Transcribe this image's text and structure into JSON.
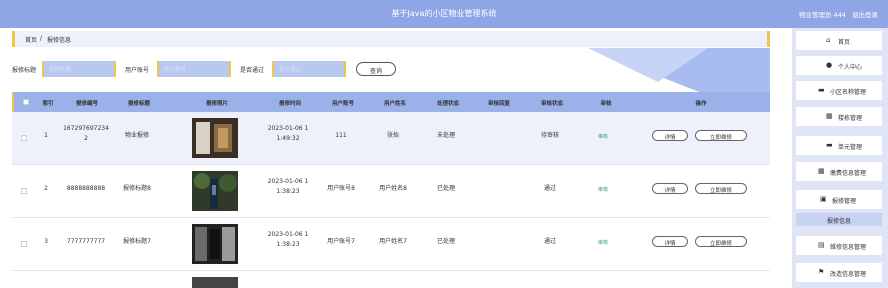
{
  "header": {
    "title": "基于Java的小区物业管理系统",
    "user": "物业管理员 444",
    "logout": "退出登录"
  },
  "breadcrumb": {
    "home": "首页",
    "sep": "/",
    "current": "报修信息"
  },
  "search": {
    "f1_label": "报修标题",
    "f1_placeholder": "报修标题",
    "f2_label": "用户账号",
    "f2_placeholder": "用户账号",
    "f3_label": "是否通过",
    "f3_placeholder": "是否通过",
    "button": "查询"
  },
  "table": {
    "headers": [
      "索引",
      "报修编号",
      "报修标题",
      "报修照片",
      "报修时间",
      "用户账号",
      "用户姓名",
      "处理状态",
      "审核回复",
      "审核状态",
      "审核",
      "操作"
    ],
    "rows": [
      {
        "index": "1",
        "no_a": "167297697234",
        "no_b": "2",
        "title": "物业报修",
        "time_a": "2023-01-06 1",
        "time_b": "1:49:32",
        "account": "111",
        "name": "张怡",
        "proc": "未处理",
        "reply": "",
        "status": "待审核",
        "audit": "审核",
        "detail": "详情",
        "repair": "立即维修"
      },
      {
        "index": "2",
        "no_a": "8888888888",
        "no_b": "",
        "title": "报修标题8",
        "time_a": "2023-01-06 1",
        "time_b": "1:38:23",
        "account": "用户账号8",
        "name": "用户姓名8",
        "proc": "已处理",
        "reply": "",
        "status": "通过",
        "audit": "审核",
        "detail": "详情",
        "repair": "立即维修"
      },
      {
        "index": "3",
        "no_a": "7777777777",
        "no_b": "",
        "title": "报修标题7",
        "time_a": "2023-01-06 1",
        "time_b": "1:38:23",
        "account": "用户账号7",
        "name": "用户姓名7",
        "proc": "已处理",
        "reply": "",
        "status": "通过",
        "audit": "审核",
        "detail": "详情",
        "repair": "立即维修"
      }
    ]
  },
  "sidebar": {
    "items": [
      {
        "icon": "home-icon",
        "glyph": "⌂",
        "label": "首页"
      },
      {
        "icon": "person-icon",
        "glyph": "●",
        "label": "个人中心"
      },
      {
        "icon": "community-icon",
        "glyph": "▬",
        "label": "小区名称管理"
      },
      {
        "icon": "building-icon",
        "glyph": "▦",
        "label": "楼栋管理"
      },
      {
        "icon": "unit-icon",
        "glyph": "▬",
        "label": "单元管理"
      },
      {
        "icon": "fee-icon",
        "glyph": "▦",
        "label": "缴费信息管理"
      },
      {
        "icon": "repair-icon",
        "glyph": "▣",
        "label": "报修管理"
      },
      {
        "icon": "maintenance-icon",
        "glyph": "▤",
        "label": "维修信息管理"
      },
      {
        "icon": "flag-icon",
        "glyph": "⚑",
        "label": "改造信息管理"
      }
    ],
    "sub_item": "报修信息"
  },
  "colors": {
    "header": "#8fa6e6",
    "accent_yellow": "#f0c64a",
    "table_header": "#9ab1ea",
    "sidebar_bg": "#dfe4f6"
  }
}
